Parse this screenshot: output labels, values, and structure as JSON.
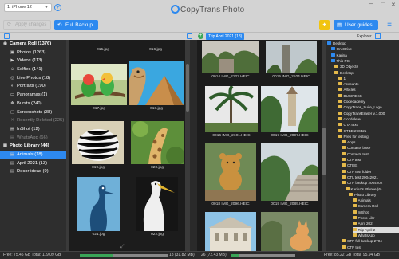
{
  "app": {
    "title": "CopyTrans Photo"
  },
  "device": {
    "name": "iPhone 12",
    "prefix": "1:"
  },
  "toolbar": {
    "apply_label": "Apply changes",
    "backup_label": "Full Backup",
    "guides_label": "User guides"
  },
  "right_pane": {
    "path_label": "Trip April 2021 (18)",
    "explorer_label": "Explorer"
  },
  "sidebar": {
    "items": [
      {
        "label": "Camera Roll (1376)",
        "icon": "camera-icon",
        "head": true
      },
      {
        "label": "Photos (1263)",
        "icon": "photo-icon"
      },
      {
        "label": "Videos (113)",
        "icon": "video-icon"
      },
      {
        "label": "Selfies (141)",
        "icon": "selfie-icon"
      },
      {
        "label": "Live Photos (18)",
        "icon": "live-photo-icon"
      },
      {
        "label": "Portraits (190)",
        "icon": "portrait-icon"
      },
      {
        "label": "Panoramas (1)",
        "icon": "panorama-icon"
      },
      {
        "label": "Bursts (240)",
        "icon": "burst-icon"
      },
      {
        "label": "Screenshots (38)",
        "icon": "screenshot-icon"
      },
      {
        "label": "Recently Deleted (225)",
        "icon": "trash-icon",
        "dim": true
      },
      {
        "label": "InShot (12)",
        "icon": "folder-icon"
      },
      {
        "label": "WhatsApp (66)",
        "icon": "folder-icon",
        "dim": true
      },
      {
        "label": "Photo Library (44)",
        "icon": "library-icon",
        "head": true
      },
      {
        "label": "Animals (18)",
        "icon": "folder-icon",
        "selected": true
      },
      {
        "label": "April 2021 (13)",
        "icon": "folder-icon"
      },
      {
        "label": "Decor ideas (9)",
        "icon": "folder-icon"
      }
    ]
  },
  "left_grid": {
    "captions": [
      "015.jpg",
      "016.jpg",
      "017.jpg",
      "018.jpg",
      "019.jpg",
      "020.jpg",
      "021.jpg",
      "022.jpg"
    ]
  },
  "right_grid": {
    "captions": [
      "0014 IMG_2122.HEIC",
      "0015 IMG_2104.HEIC",
      "0016 IMG_2101.HEIC",
      "0017 IMG_2097.HEIC",
      "0018 IMG_2096.HEIC",
      "0019 IMG_2089.HEIC"
    ]
  },
  "explorer": {
    "items": [
      {
        "label": "Desktop",
        "depth": 0
      },
      {
        "label": "OneDrive",
        "depth": 1
      },
      {
        "label": "Karina",
        "depth": 1
      },
      {
        "label": "This PC",
        "depth": 1
      },
      {
        "label": "3D Objects",
        "depth": 2
      },
      {
        "label": "Desktop",
        "depth": 2
      },
      {
        "label": "1",
        "depth": 3
      },
      {
        "label": "Accounts",
        "depth": 3
      },
      {
        "label": "Articles",
        "depth": 3
      },
      {
        "label": "BUSINESS",
        "depth": 3
      },
      {
        "label": "Codecademy",
        "depth": 3
      },
      {
        "label": "CopyTrans_Suite_Logo",
        "depth": 3
      },
      {
        "label": "CopyTransEraser v.1.000",
        "depth": 3
      },
      {
        "label": "ctcodeleter",
        "depth": 3
      },
      {
        "label": "CTA text",
        "depth": 3
      },
      {
        "label": "CTBE 270421",
        "depth": 3
      },
      {
        "label": "Files for testing",
        "depth": 3
      },
      {
        "label": "Apps",
        "depth": 4
      },
      {
        "label": "Contacts base",
        "depth": 4
      },
      {
        "label": "Contacts test",
        "depth": 4
      },
      {
        "label": "CTA test",
        "depth": 4
      },
      {
        "label": "CTBE",
        "depth": 4
      },
      {
        "label": "CTF test folder",
        "depth": 4
      },
      {
        "label": "CTL test 20042021",
        "depth": 4
      },
      {
        "label": "CTP backup 2004202",
        "depth": 4
      },
      {
        "label": "Karina's iPhone (6)",
        "depth": 5
      },
      {
        "label": "Photo Library",
        "depth": 6
      },
      {
        "label": "Animals",
        "depth": 7
      },
      {
        "label": "Camera Roll",
        "depth": 7
      },
      {
        "label": "InShot",
        "depth": 7
      },
      {
        "label": "Photo Libr",
        "depth": 7
      },
      {
        "label": "April 202",
        "depth": 7
      },
      {
        "label": "Trip April 2",
        "depth": 7,
        "selected": true
      },
      {
        "label": "WhatsApp",
        "depth": 7
      },
      {
        "label": "CTP full backup 2704",
        "depth": 4
      },
      {
        "label": "CTP test",
        "depth": 4
      }
    ]
  },
  "status": {
    "left_free": "Free: 75.45 GB Total: 119.09 GB",
    "left_sel": "18 (31.82 MB)",
    "right_sel": "26 (72.43 MB)",
    "right_free": "Free: 85.22 GB Total: 95.94 GB",
    "left_used_fraction": 0.37,
    "right_used_fraction": 0.11
  },
  "colors": {
    "accent": "#2d89ef",
    "bulb": "#f1c40f",
    "add": "#3aa657"
  }
}
